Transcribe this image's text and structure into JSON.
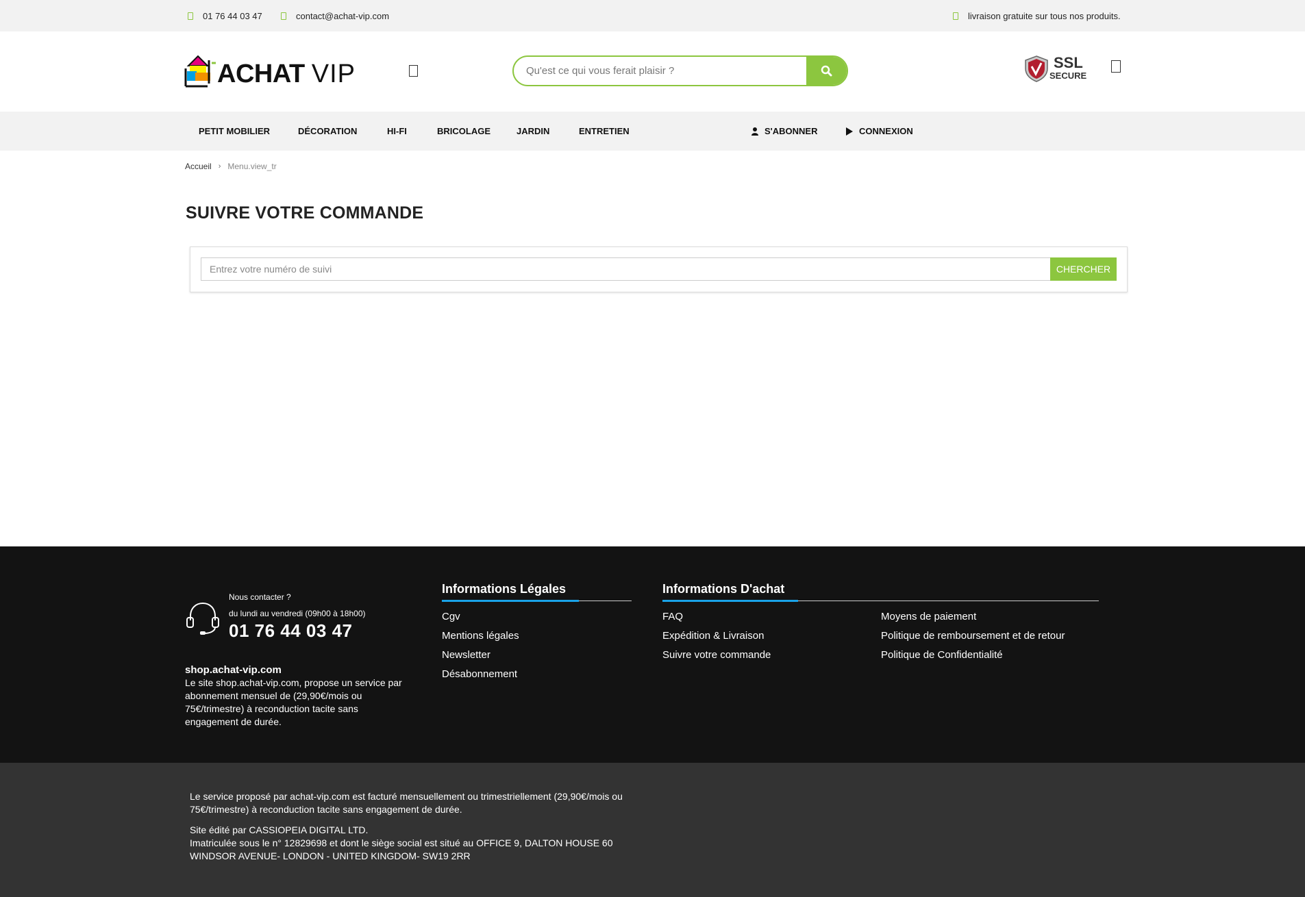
{
  "topbar": {
    "phone": "01 76 44 03 47",
    "email": "contact@achat-vip.com",
    "shipping": "livraison gratuite sur tous nos produits."
  },
  "header": {
    "logo_main": "ACHAT",
    "logo_accent": "VIP",
    "search_placeholder": "Qu'est ce qui vous ferait plaisir ?",
    "ssl_line1": "SSL",
    "ssl_line2": "SECURE"
  },
  "nav": {
    "items": [
      "PETIT MOBILIER",
      "DÉCORATION",
      "HI-FI",
      "BRICOLAGE",
      "JARDIN",
      "ENTRETIEN"
    ],
    "subscribe": "S'ABONNER",
    "login": "CONNEXION"
  },
  "breadcrumb": {
    "home": "Accueil",
    "current": "Menu.view_tr"
  },
  "main": {
    "title": "SUIVRE VOTRE COMMANDE",
    "tracking_placeholder": "Entrez votre numéro de suivi",
    "search_button": "CHERCHER"
  },
  "footer": {
    "contact_question": "Nous contacter ?",
    "contact_hours": "du lundi au vendredi (09h00 à 18h00)",
    "contact_phone": "01 76 44 03 47",
    "shop_name": "shop.achat-vip.com",
    "shop_desc": "Le site shop.achat-vip.com, propose un service par abonnement mensuel de (29,90€/mois ou 75€/trimestre) à reconduction tacite sans engagement de durée.",
    "legal_title": "Informations Légales",
    "legal_links": [
      "Cgv",
      "Mentions légales",
      "Newsletter",
      "Désabonnement"
    ],
    "purchase_title": "Informations D'achat",
    "purchase_links_col1": [
      "FAQ",
      "Expédition & Livraison",
      "Suivre votre commande"
    ],
    "purchase_links_col2": [
      "Moyens de paiement",
      "Politique de remboursement et de retour",
      "Politique de Confidentialité"
    ]
  },
  "subfooter": {
    "billing": "Le service proposé par achat-vip.com est facturé mensuellement ou trimestriellement (29,90€/mois ou 75€/trimestre) à reconduction tacite sans engagement de durée.",
    "publisher": "Site édité par CASSIOPEIA DIGITAL LTD.",
    "registration": "Imatriculée sous le n° 12829698 et dont le siège social est situé au OFFICE 9, DALTON HOUSE 60 WINDSOR AVENUE- LONDON - UNITED KINGDOM- SW19 2RR"
  },
  "colors": {
    "accent_green": "#8cc63f",
    "accent_blue": "#1aa3e8",
    "footer_bg": "#131313",
    "subfooter_bg": "#333333",
    "topbar_bg": "#f2f2f2"
  },
  "icons": {
    "topbar_phone": "phone-icon",
    "topbar_email": "mail-icon",
    "topbar_shipping": "truck-icon",
    "menu": "menu-icon",
    "search": "search-icon",
    "ssl": "shield-icon",
    "cart": "cart-icon",
    "subscribe": "user-icon",
    "login": "play-icon",
    "contact": "headset-icon"
  }
}
